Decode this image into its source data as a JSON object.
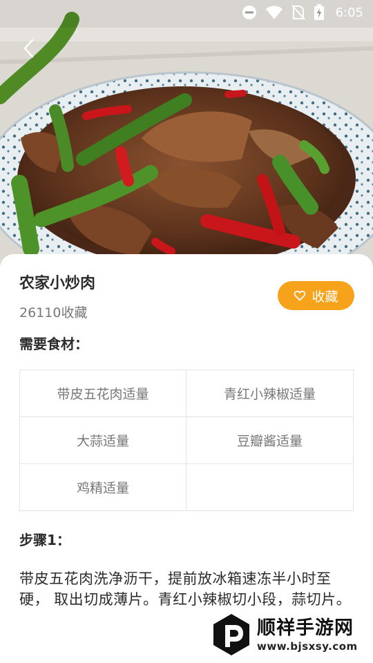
{
  "status_bar": {
    "time": "6:05",
    "icons": [
      "do-not-disturb-icon",
      "wifi-icon",
      "no-sim-icon",
      "battery-charging-icon"
    ]
  },
  "header": {
    "back_icon": "chevron-left-icon",
    "hero_image": "stir-fried-pork-with-peppers-photo"
  },
  "recipe": {
    "title": "农家小炒肉",
    "favorite_count": "26110收藏",
    "favorite_button": {
      "label": "收藏",
      "icon": "heart-outline-icon",
      "color": "#F7A21B"
    }
  },
  "ingredients": {
    "heading": "需要食材：",
    "items": [
      "带皮五花肉适量",
      "青红小辣椒适量",
      "大蒜适量",
      "豆瓣酱适量",
      "鸡精适量",
      ""
    ]
  },
  "steps": [
    {
      "heading": "步骤1：",
      "text": "带皮五花肉洗净沥干，提前放冰箱速冻半小时至硬， 取出切成薄片。青红小辣椒切小段，蒜切片。"
    }
  ],
  "watermark": {
    "brand": "顺祥手游网",
    "url": "www.bjsxsy.com"
  }
}
